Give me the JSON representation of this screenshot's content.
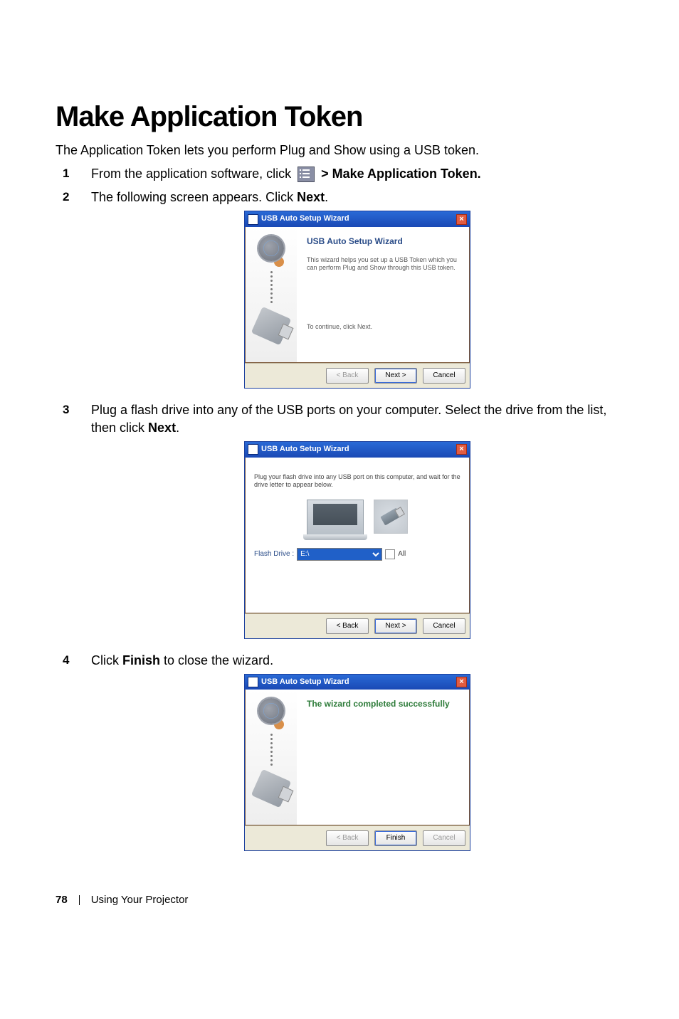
{
  "title": "Make Application Token",
  "intro": "The Application Token lets you perform Plug and Show using a USB token.",
  "steps": {
    "s1": {
      "num": "1",
      "pre": "From the application software, click ",
      "post": " > Make Application Token."
    },
    "s2": {
      "num": "2",
      "text_pre": "The following screen appears. Click ",
      "text_bold": "Next",
      "text_post": "."
    },
    "s3": {
      "num": "3",
      "text_pre": "Plug a flash drive into any of the USB ports on your computer. Select the drive from the list, then click ",
      "text_bold": "Next",
      "text_post": "."
    },
    "s4": {
      "num": "4",
      "text_pre": "Click ",
      "text_bold": "Finish",
      "text_post": " to close the wizard."
    }
  },
  "wiz1": {
    "titlebar": "USB Auto Setup Wizard",
    "heading": "USB Auto Setup Wizard",
    "desc": "This wizard helps you set up a USB Token which you can perform Plug and Show through this USB token.",
    "continue": "To continue, click Next.",
    "back": "< Back",
    "next": "Next >",
    "cancel": "Cancel",
    "close": "×"
  },
  "wiz2": {
    "titlebar": "USB Auto Setup Wizard",
    "desc": "Plug your flash drive into any USB port on this computer, and wait for the drive letter to appear below.",
    "flash_label": "Flash Drive :",
    "flash_value": "E:\\",
    "all": "All",
    "back": "< Back",
    "next": "Next >",
    "cancel": "Cancel",
    "close": "×"
  },
  "wiz3": {
    "titlebar": "USB Auto Setup Wizard",
    "heading": "The wizard completed successfully",
    "back": "< Back",
    "finish": "Finish",
    "cancel": "Cancel",
    "close": "×"
  },
  "footer": {
    "page": "78",
    "section": "Using Your Projector"
  }
}
